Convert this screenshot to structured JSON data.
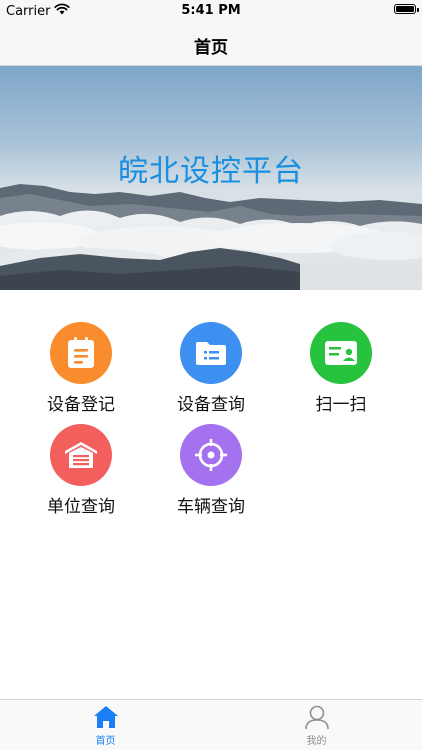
{
  "status_bar": {
    "carrier": "Carrier",
    "time": "5:41 PM"
  },
  "nav": {
    "title": "首页"
  },
  "banner": {
    "title": "皖北设控平台"
  },
  "grid": {
    "items": [
      {
        "label": "设备登记",
        "color": "#f98d2e",
        "icon": "clipboard-icon"
      },
      {
        "label": "设备查询",
        "color": "#3d8ff0",
        "icon": "folder-icon"
      },
      {
        "label": "扫一扫",
        "color": "#27c23e",
        "icon": "id-card-icon"
      },
      {
        "label": "单位查询",
        "color": "#f25f5c",
        "icon": "garage-icon"
      },
      {
        "label": "车辆查询",
        "color": "#a472ee",
        "icon": "target-icon"
      }
    ]
  },
  "tab_bar": {
    "tabs": [
      {
        "label": "首页",
        "active": true
      },
      {
        "label": "我的",
        "active": false
      }
    ],
    "active_color": "#1a7ff5",
    "inactive_color": "#8e8e93"
  }
}
